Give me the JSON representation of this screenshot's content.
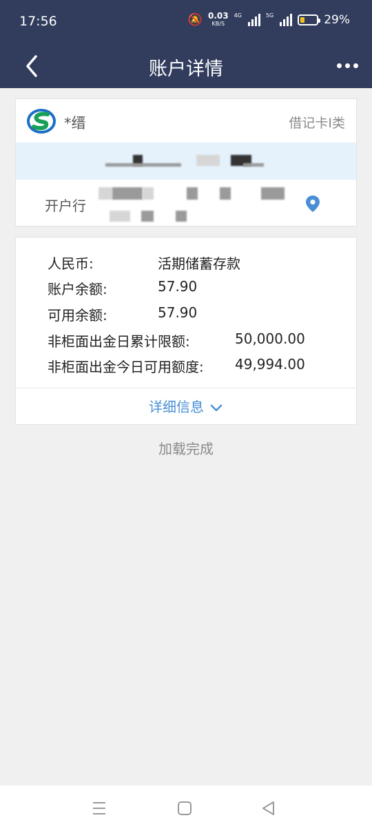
{
  "status_bar": {
    "time": "17:56",
    "speed_value": "0.03",
    "speed_unit": "KB/S",
    "net1": "4G",
    "net2": "5G",
    "battery_pct": "29%",
    "battery_level": 0.29
  },
  "header": {
    "title": "账户详情",
    "back_icon": "chevron-left-icon",
    "more_icon": "more-dots-icon"
  },
  "account": {
    "name": "*缙",
    "card_type": "借记卡I类",
    "bank_label": "开户行",
    "location_icon": "location-pin-icon"
  },
  "balance": {
    "currency_label": "人民币:",
    "currency_value": "活期储蓄存款",
    "balance_label": "账户余额:",
    "balance_value": "57.90",
    "available_label": "可用余额:",
    "available_value": "57.90",
    "daily_limit_label": "非柜面出金日累计限额:",
    "daily_limit_value": "50,000.00",
    "today_available_label": "非柜面出金今日可用额度:",
    "today_available_value": "49,994.00",
    "details_label": "详细信息"
  },
  "footer": {
    "loaded_text": "加载完成"
  },
  "colors": {
    "header_bg": "#323d5e",
    "accent_blue": "#4a8fd6",
    "account_bar_bg": "#e5f2fc",
    "logo_green": "#18a05a",
    "logo_blue": "#1d6fc4"
  }
}
